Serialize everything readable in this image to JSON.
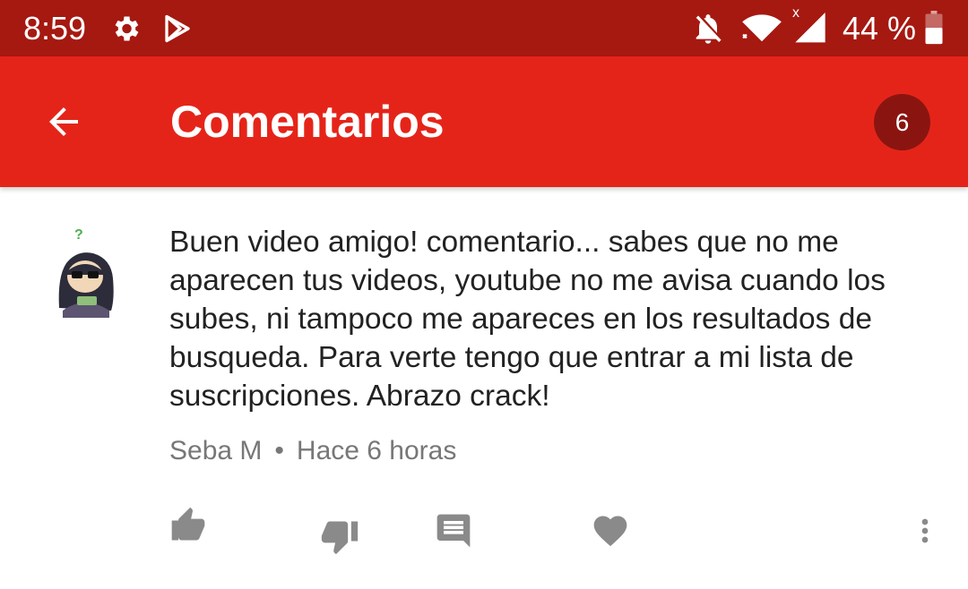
{
  "status_bar": {
    "time": "8:59",
    "icons": [
      "gear-icon",
      "play-store-icon",
      "bell-off-icon",
      "wifi-icon",
      "signal-icon",
      "battery-icon"
    ],
    "signal_marker": "x",
    "battery_percent": "44 %"
  },
  "app_bar": {
    "back_icon": "arrow-left-icon",
    "title": "Comentarios",
    "count": "6"
  },
  "comment": {
    "text": "Buen video amigo! comentario... sabes que no me aparecen tus videos, youtube no me avisa cuando los subes, ni tampoco me apareces en los resultados de busqueda. Para verte tengo que entrar a mi lista de suscripciones. Abrazo crack!",
    "author": "Seba M",
    "separator": "•",
    "time": "Hace 6 horas",
    "actions": [
      "thumb-up-icon",
      "thumb-down-icon",
      "reply-icon",
      "heart-icon",
      "more-vert-icon"
    ]
  },
  "colors": {
    "status_bar_bg": "#a51911",
    "app_bar_bg": "#e52419",
    "badge_bg": "#8a1510",
    "action_icon": "#8a8a8a"
  }
}
